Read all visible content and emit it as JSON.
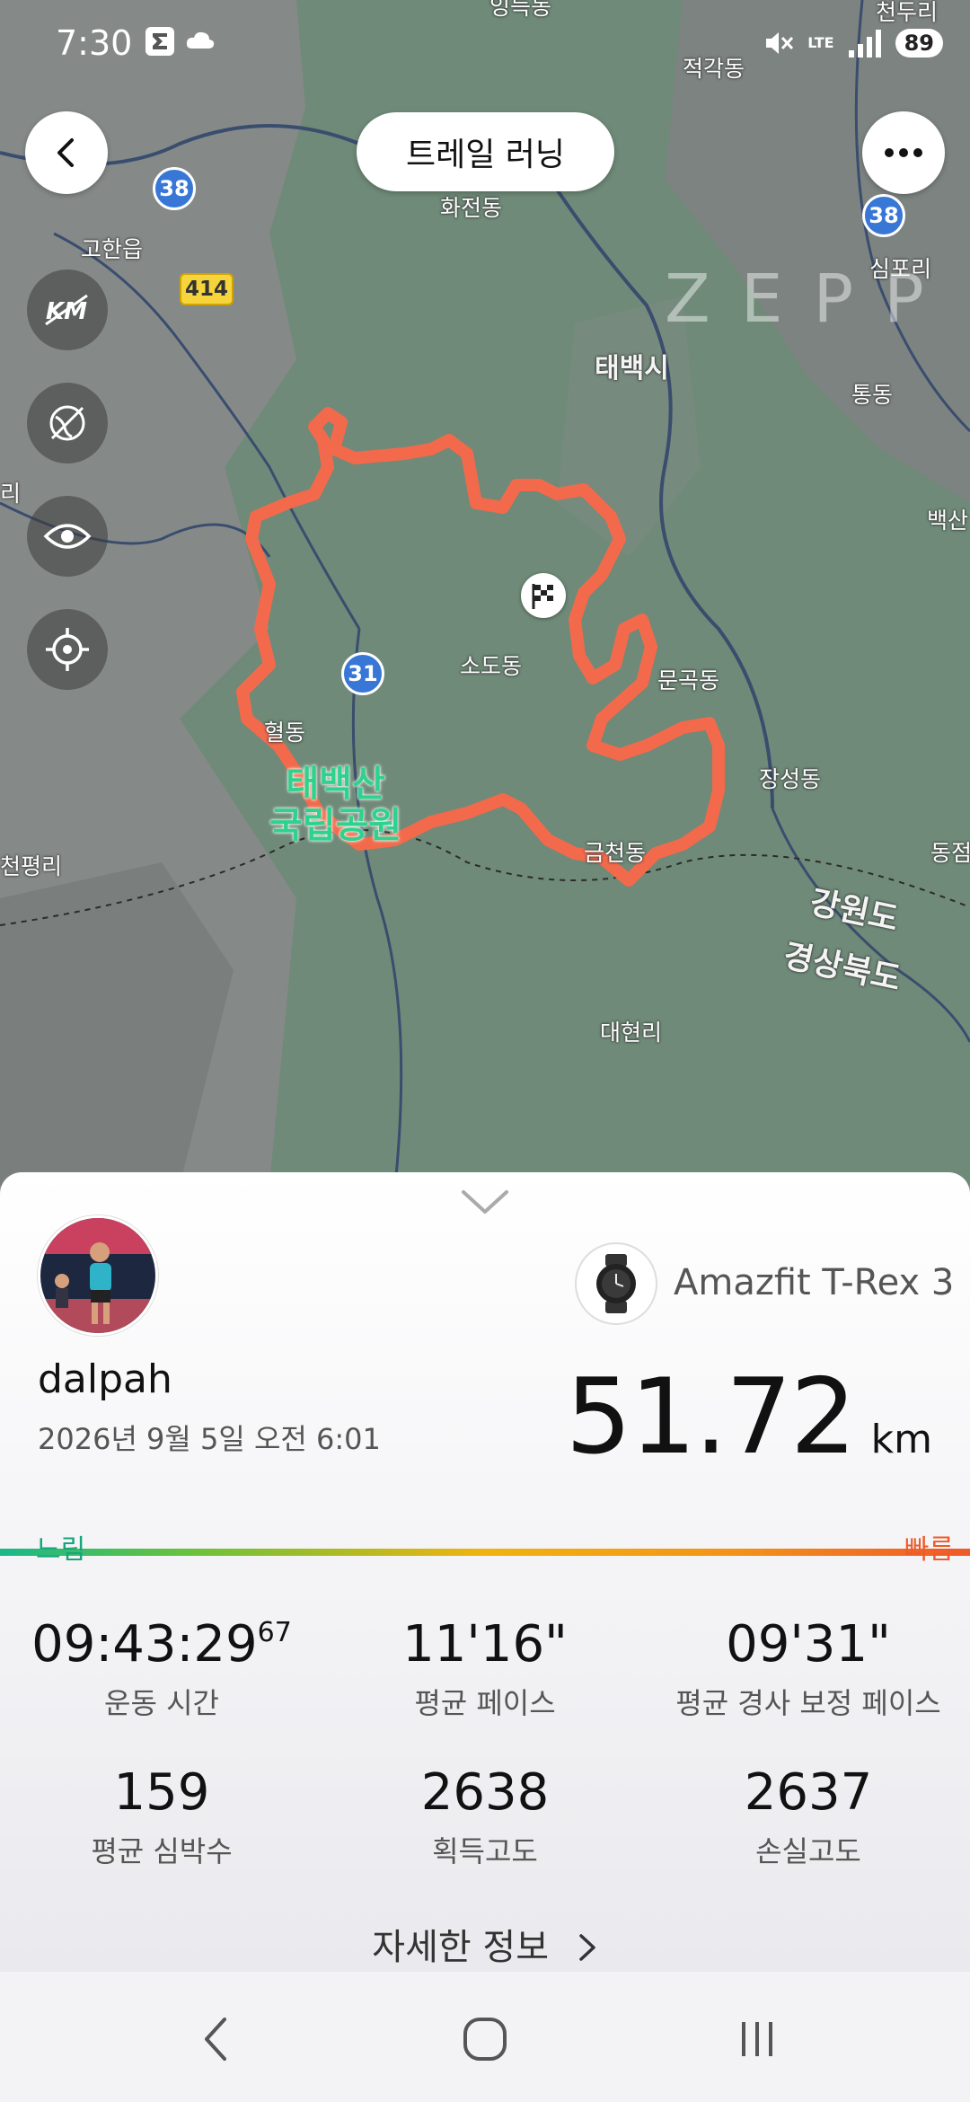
{
  "status_bar": {
    "time": "7:30",
    "battery": "89",
    "network": "LTE"
  },
  "header": {
    "title": "트레일 러닝"
  },
  "map": {
    "watermark": "ZEPP",
    "labels": {
      "top_village": "잉득동",
      "top_right": "천두리",
      "jeokgak": "적각동",
      "hwajeon": "화전동",
      "gohan": "고한읍",
      "simpo": "심포리",
      "taebaek": "태백시",
      "tong": "통동",
      "baeksan": "백산",
      "sodo": "소도동",
      "mungok": "문곡동",
      "hyeol": "혈동",
      "park": "태백산\n국립공원",
      "jangseong": "장성동",
      "geumcheon": "금천동",
      "dongjeom": "동점",
      "gangwon": "강원도",
      "gyeongbuk": "경상북도",
      "daehyeon": "대현리",
      "left_edge": "리",
      "left_bottom": "천평리"
    },
    "route_badges": [
      "38",
      "414",
      "38",
      "31"
    ]
  },
  "summary": {
    "username": "dalpah",
    "datetime": "2026년 9월 5일 오전 6:01",
    "device": "Amazfit T-Rex 3",
    "distance_value": "51.72",
    "distance_unit": "km",
    "pace_slow_label": "느림",
    "pace_fast_label": "빠름",
    "stats": [
      {
        "value": "09:43:29",
        "value_sup": "67",
        "label": "운동 시간"
      },
      {
        "value": "11'16\"",
        "value_sup": "",
        "label": "평균 페이스"
      },
      {
        "value": "09'31\"",
        "value_sup": "",
        "label": "평균 경사 보정 페이스"
      },
      {
        "value": "159",
        "value_sup": "",
        "label": "평균 심박수"
      },
      {
        "value": "2638",
        "value_sup": "",
        "label": "획득고도"
      },
      {
        "value": "2637",
        "value_sup": "",
        "label": "손실고도"
      }
    ],
    "detail_link": "자세한 정보"
  },
  "colors": {
    "route": "#f26a4b",
    "map_bg": "#6f8a78",
    "slow": "#17a57a",
    "fast": "#ee5a2a"
  }
}
